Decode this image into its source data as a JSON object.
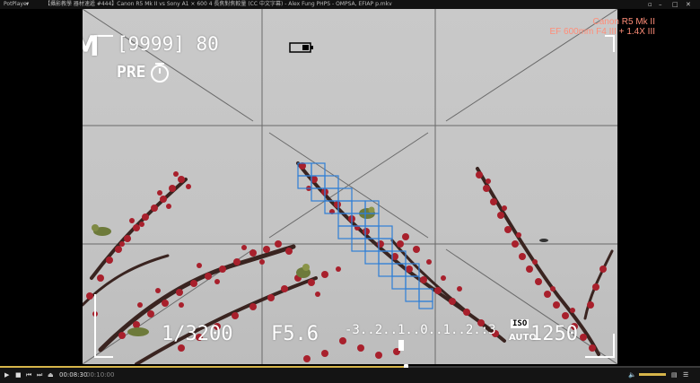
{
  "window": {
    "app_name": "PotPlayer",
    "title": "【攝影教學 器材速遞 #444】Canon R5 Mk II vs Sony A1 × 600 4 長焦對焦較量 (CC 中文字幕) - Alex Fung PHPS - OMPSA, EFIAP p.mkv"
  },
  "camera_osd": {
    "mode": "M",
    "shots_remaining": "[9999] 80",
    "pre_capture": "PRE",
    "shutter": "1/3200",
    "aperture": "F5.6",
    "exposure_scale": "-3..2..1..0..1..2.:3",
    "iso_label": "ISO",
    "iso_auto": "AUTO",
    "iso_value": "1250"
  },
  "lens_overlay": {
    "line1": "Canon R5 Mk II",
    "line2": "EF 600mm F4 III + 1.4X III"
  },
  "player": {
    "time_current": "00:08:30",
    "time_total": "00:10:00",
    "progress_fraction": 0.58
  },
  "colors": {
    "accent": "#d6b54a",
    "af_box": "#2f7fd6",
    "lens_text": "#ff8d78",
    "blossom": "#a8202c",
    "branch": "#3a2420"
  }
}
